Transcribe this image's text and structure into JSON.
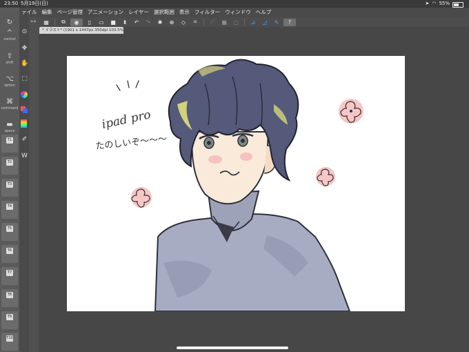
{
  "status_bar": {
    "time": "23:50",
    "date": "5月19日(日)",
    "battery": "55%",
    "battery_level": 0.55
  },
  "menu": [
    {
      "id": "file",
      "label": "ァイル"
    },
    {
      "id": "edit",
      "label": "編集"
    },
    {
      "id": "page",
      "label": "ページ管理"
    },
    {
      "id": "animation",
      "label": "アニメーション"
    },
    {
      "id": "layer",
      "label": "レイヤー"
    },
    {
      "id": "selection",
      "label": "選択範囲"
    },
    {
      "id": "view",
      "label": "表示"
    },
    {
      "id": "filter",
      "label": "フィルター"
    },
    {
      "id": "window",
      "label": "ウィンドウ"
    },
    {
      "id": "help",
      "label": "ヘルプ"
    }
  ],
  "document_tab": {
    "label": "* イラスト* (1901 x 1447px 350dpi 103.5%)"
  },
  "modifiers": {
    "control": "control",
    "shift": "shift",
    "option": "option",
    "command": "command",
    "space": "space"
  },
  "shortcut_slots": [
    "T1",
    "T2",
    "T3",
    "T4",
    "T5",
    "T6",
    "T7",
    "T8",
    "T9",
    "T10"
  ],
  "toolbar_icons": {
    "help": "?"
  },
  "canvas": {
    "handwriting_line1": "ipad pro",
    "handwriting_line2": "たのしいぞ〜〜〜"
  }
}
